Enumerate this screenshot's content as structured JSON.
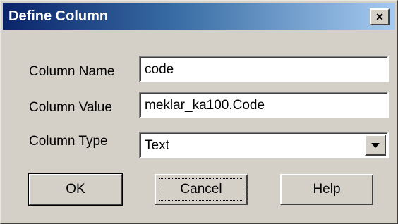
{
  "window": {
    "title": "Define Column",
    "close_label": "×"
  },
  "form": {
    "column_name": {
      "label": "Column Name",
      "value": "code"
    },
    "column_value": {
      "label": "Column Value",
      "value": "meklar_ka100.Code"
    },
    "column_type": {
      "label": "Column Type",
      "value": "Text"
    }
  },
  "buttons": {
    "ok": "OK",
    "cancel": "Cancel",
    "help": "Help"
  },
  "colors": {
    "titlebar_start": "#0a246a",
    "titlebar_end": "#a6caf0",
    "dialog_bg": "#d4d0c8"
  }
}
